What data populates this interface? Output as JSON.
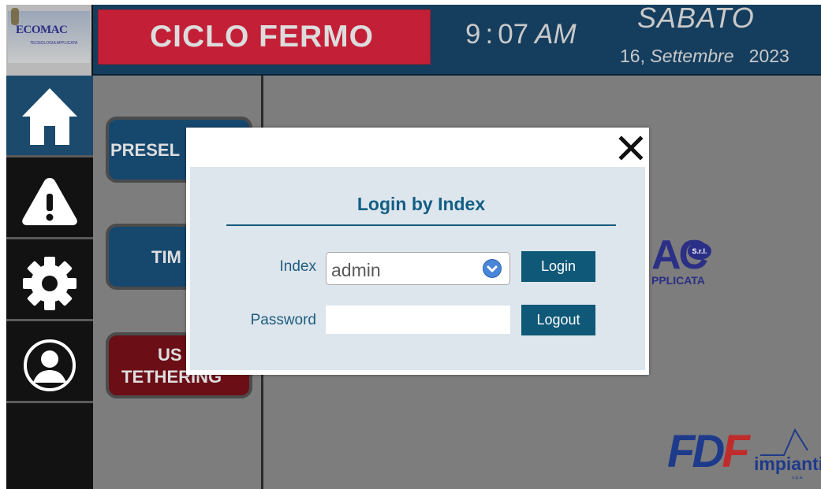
{
  "header": {
    "brand": "ECOMAC",
    "brand_tagline": "TECNOLOGIA APPLICATA",
    "cycle_status": "CICLO FERMO",
    "time": {
      "hours": "9",
      "minutes": "07",
      "ampm": "AM"
    },
    "day_of_week": "SABATO",
    "date": {
      "day": "16,",
      "month": "Settembre",
      "year": "2023"
    }
  },
  "nav": {
    "items": [
      {
        "icon": "home-icon",
        "active": true
      },
      {
        "icon": "warning-icon",
        "active": false
      },
      {
        "icon": "gear-icon",
        "active": false
      },
      {
        "icon": "user-icon",
        "active": false
      }
    ]
  },
  "left_panel": {
    "buttons": [
      {
        "label": "PRESEL",
        "color": "#16486e"
      },
      {
        "label": "TIM",
        "color": "#16486e"
      },
      {
        "label_line1": "US",
        "label_line2": "TETHERING",
        "color": "#6b0e16"
      }
    ]
  },
  "background_logos": {
    "ecomac_partial": "AC",
    "ecomac_srl": "S.r.l.",
    "ecomac_partial_tagline": "PPLICATA",
    "fdf": {
      "fd": "FD",
      "f": "F",
      "impianti": "impianti",
      "spa": "s.p.a."
    }
  },
  "login_dialog": {
    "title": "Login by Index",
    "index_label": "Index",
    "index_value": "admin",
    "password_label": "Password",
    "password_value": "",
    "login_button": "Login",
    "logout_button": "Logout",
    "close_icon": "close-icon"
  },
  "colors": {
    "header_bg": "#153e5e",
    "status_bg": "#c32038",
    "panel_bg": "#7d7d7d",
    "accent": "#0f5878"
  }
}
